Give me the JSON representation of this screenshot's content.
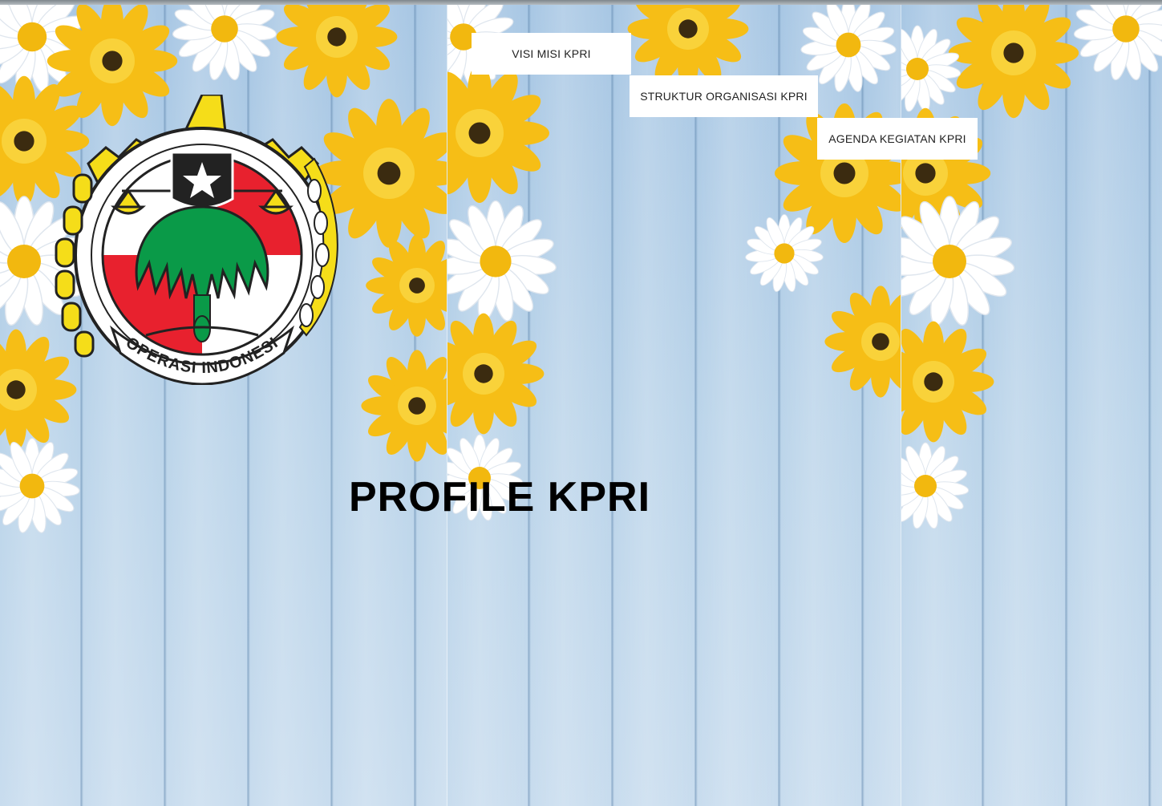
{
  "nav": {
    "items": [
      {
        "label": "VISI MISI KPRI"
      },
      {
        "label": "STRUKTUR ORGANISASI KPRI"
      },
      {
        "label": "AGENDA KEGIATAN KPRI"
      }
    ]
  },
  "logo": {
    "text": "KOPERASI INDONESIA",
    "colors": {
      "gold": "#f5dd19",
      "red": "#e8212e",
      "green": "#0a9a48",
      "black": "#222222"
    }
  },
  "main": {
    "title": "PROFILE KPRI"
  },
  "background": {
    "wood": "#a9c8e2",
    "flower_yellow": "#f7c21a",
    "flower_white": "#ffffff"
  }
}
